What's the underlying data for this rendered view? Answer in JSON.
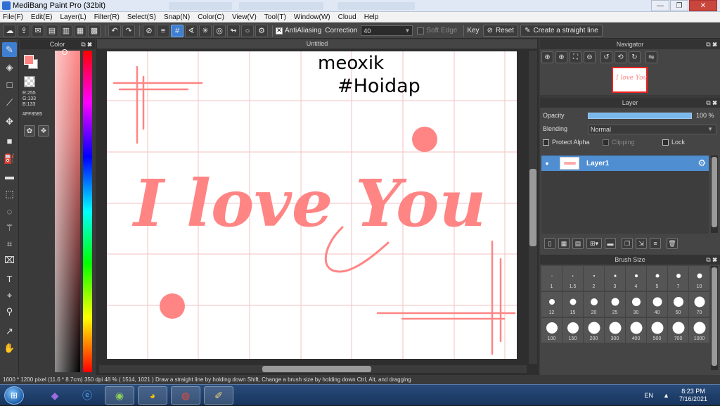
{
  "window": {
    "title": "MediBang Paint Pro (32bit)",
    "minimize": "—",
    "restore": "❐",
    "close": "✕"
  },
  "menu": [
    "File(F)",
    "Edit(E)",
    "Layer(L)",
    "Filter(R)",
    "Select(S)",
    "Snap(N)",
    "Color(C)",
    "View(V)",
    "Tool(T)",
    "Window(W)",
    "Cloud",
    "Help"
  ],
  "toolbar": {
    "antialiasing_label": "AntiAliasing",
    "antialiasing_checked": true,
    "correction_label": "Correction",
    "correction_value": "40",
    "soft_edge_label": "Soft Edge",
    "soft_edge_checked": false,
    "key_label": "Key",
    "reset_label": "Reset",
    "straight_line_label": "Create a straight line"
  },
  "color_panel": {
    "title": "Color",
    "foreground": "#ff8585",
    "background": "#ffffff",
    "r": "R:255",
    "g": "G:133",
    "b": "B:133",
    "hex": "#FF8585"
  },
  "document": {
    "tab_title": "Untitled",
    "canvas": {
      "handwriting_line1": "meoxik",
      "handwriting_line2": "#Hoidap",
      "main_text": "I love You",
      "ink_color": "#ff8585"
    }
  },
  "navigator": {
    "title": "Navigator",
    "thumb_text": "I love You"
  },
  "layer_panel": {
    "title": "Layer",
    "opacity_label": "Opacity",
    "opacity_value": "100 %",
    "opacity_fraction": 1.0,
    "blending_label": "Blending",
    "blending_value": "Normal",
    "protect_alpha_label": "Protect Alpha",
    "clipping_label": "Clipping",
    "lock_label": "Lock",
    "layers": [
      {
        "name": "Layer1",
        "visible": true,
        "selected": true
      }
    ]
  },
  "brush_size": {
    "title": "Brush Size",
    "sizes": [
      "1",
      "1.5",
      "2",
      "3",
      "4",
      "5",
      "7",
      "10",
      "12",
      "15",
      "20",
      "25",
      "30",
      "40",
      "50",
      "70",
      "100",
      "150",
      "200",
      "300",
      "400",
      "500",
      "700",
      "1000"
    ]
  },
  "status": {
    "size": "1600 * 1200 pixel",
    "physical": "(11.6 * 8.7cm)",
    "dpi": "350 dpi",
    "zoom": "48 %",
    "cursor": "( 1514, 1021 )",
    "hint": "Draw a straight line by holding down Shift, Change a brush size by holding down Ctrl, Alt, and dragging"
  },
  "taskbar": {
    "language": "EN",
    "time": "8:23 PM",
    "date": "7/16/2021"
  }
}
